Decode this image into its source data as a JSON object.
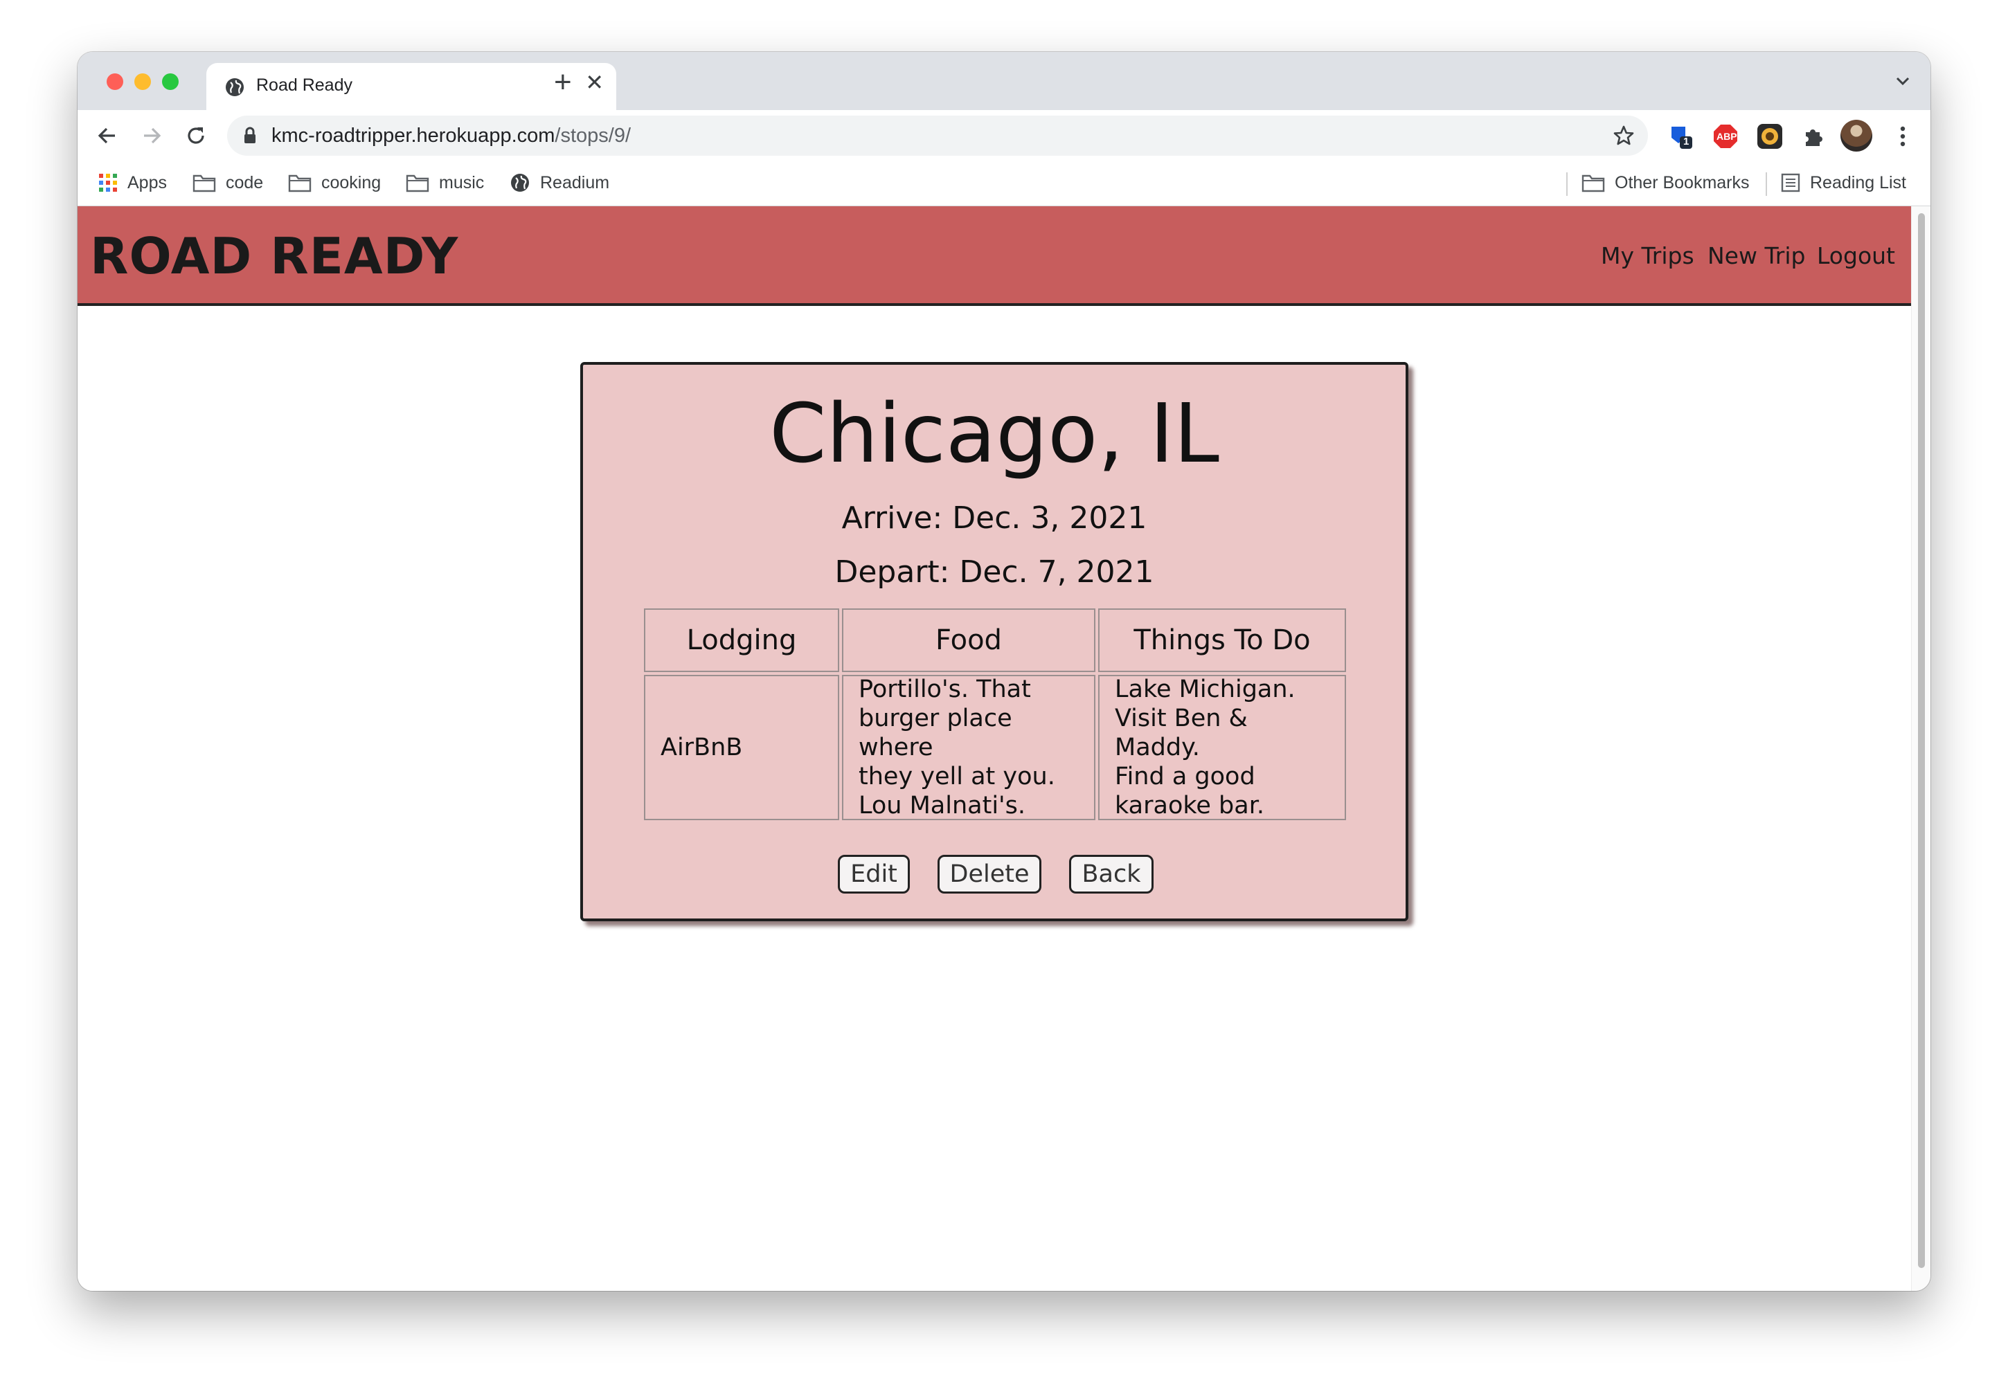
{
  "browser": {
    "tab_title": "Road Ready",
    "url_host": "kmc-roadtripper.herokuapp.com",
    "url_path": "/stops/9/",
    "extension_badge": "1",
    "adblock_label": "ABP",
    "bookmarks": [
      {
        "label": "Apps",
        "icon": "apps-grid-icon"
      },
      {
        "label": "code",
        "icon": "folder-icon"
      },
      {
        "label": "cooking",
        "icon": "folder-icon"
      },
      {
        "label": "music",
        "icon": "folder-icon"
      },
      {
        "label": "Readium",
        "icon": "globe-icon"
      }
    ],
    "other_bookmarks": "Other Bookmarks",
    "reading_list": "Reading List"
  },
  "site": {
    "brand": "ROAD READY",
    "nav": [
      "My Trips",
      "New Trip",
      "Logout"
    ],
    "accent_color": "#c75d5d",
    "card_color": "#ecc7c7"
  },
  "stop": {
    "city": "Chicago, IL",
    "arrive": "Arrive: Dec. 3, 2021",
    "depart": "Depart: Dec. 7, 2021",
    "columns": [
      "Lodging",
      "Food",
      "Things To Do"
    ],
    "values": [
      "AirBnB",
      "Portillo's. That\nburger place where\nthey yell at you.\nLou Malnati's.",
      "Lake Michigan.\nVisit Ben & Maddy.\nFind a good\nkaraoke bar."
    ],
    "actions": [
      "Edit",
      "Delete",
      "Back"
    ]
  }
}
